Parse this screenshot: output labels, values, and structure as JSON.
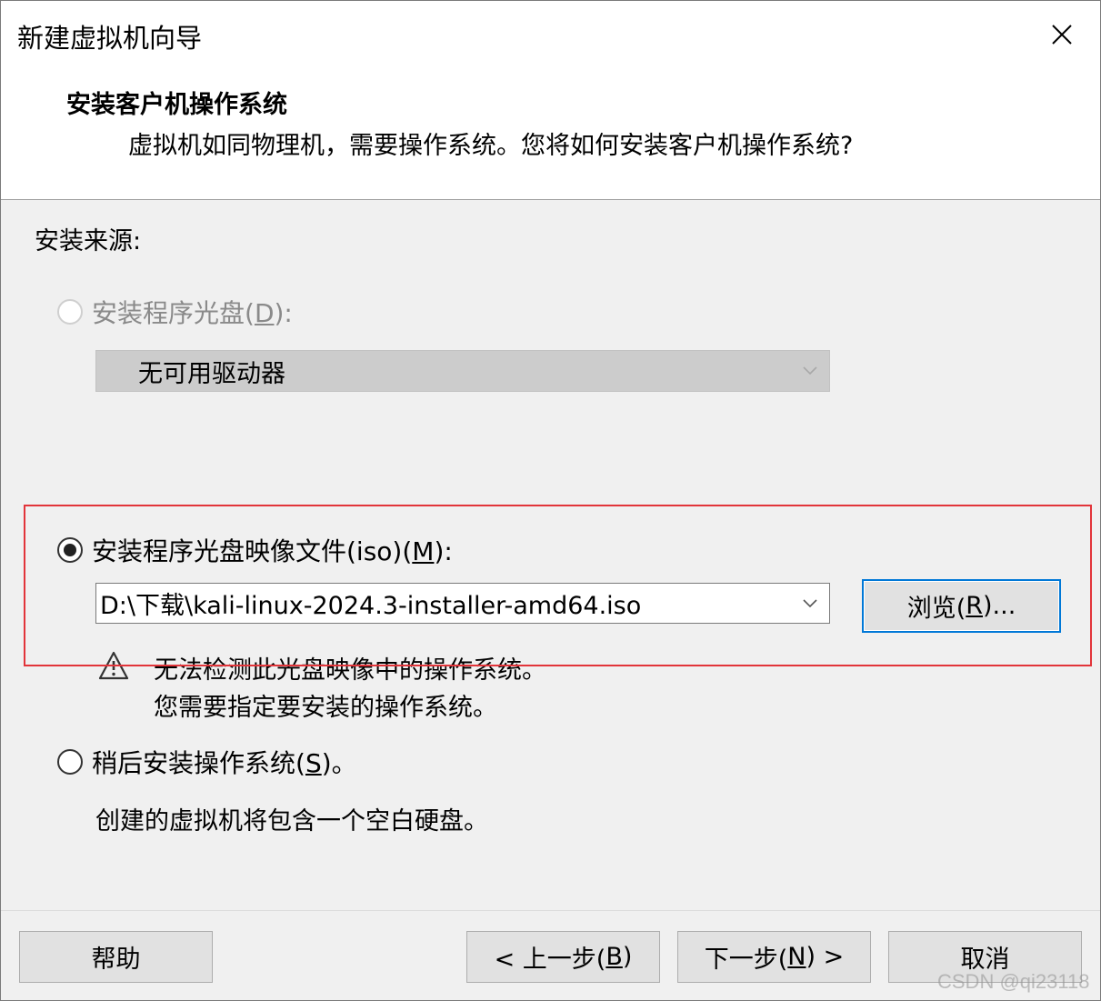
{
  "window": {
    "title": "新建虚拟机向导"
  },
  "header": {
    "heading": "安装客户机操作系统",
    "subheading": "虚拟机如同物理机，需要操作系统。您将如何安装客户机操作系统?"
  },
  "install_source": {
    "label": "安装来源:",
    "disc_option": {
      "label_prefix": "安装程序光盘(",
      "accelerator": "D",
      "label_suffix": "):",
      "enabled": false,
      "selected": false,
      "drive_value": "无可用驱动器"
    },
    "iso_option": {
      "label_prefix": "安装程序光盘映像文件(iso)(",
      "accelerator": "M",
      "label_suffix": "):",
      "enabled": true,
      "selected": true,
      "path_value": "D:\\下载\\kali-linux-2024.3-installer-amd64.iso",
      "browse_prefix": "浏览(",
      "browse_accelerator": "R",
      "browse_suffix": ")...",
      "warning_line1": "无法检测此光盘映像中的操作系统。",
      "warning_line2": "您需要指定要安装的操作系统。"
    },
    "later_option": {
      "label_prefix": "稍后安装操作系统(",
      "accelerator": "S",
      "label_suffix": ")。",
      "selected": false,
      "description": "创建的虚拟机将包含一个空白硬盘。"
    }
  },
  "footer": {
    "help": "帮助",
    "back_prefix": "< 上一步(",
    "back_accelerator": "B",
    "back_suffix": ")",
    "next_prefix": "下一步(",
    "next_accelerator": "N",
    "next_suffix": ") >",
    "cancel": "取消"
  },
  "watermark": "CSDN @qi23118",
  "colors": {
    "highlight_box": "#e2343a",
    "focus_border": "#0078d7",
    "dialog_bg": "#f0f0f0"
  }
}
